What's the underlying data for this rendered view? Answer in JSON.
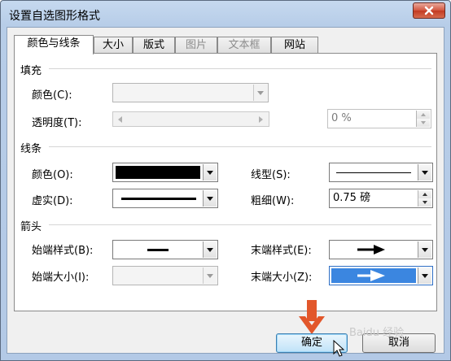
{
  "window": {
    "title": "设置自选图形格式"
  },
  "tabs": [
    {
      "label": "颜色与线条",
      "state": "active"
    },
    {
      "label": "大小",
      "state": "normal"
    },
    {
      "label": "版式",
      "state": "normal"
    },
    {
      "label": "图片",
      "state": "disabled"
    },
    {
      "label": "文本框",
      "state": "disabled"
    },
    {
      "label": "网站",
      "state": "normal"
    }
  ],
  "fill": {
    "heading": "填充",
    "color_label": "颜色(C):",
    "transparency_label": "透明度(T):",
    "transparency_value": "0 %"
  },
  "line": {
    "heading": "线条",
    "color_label": "颜色(O):",
    "color_value": "#000000",
    "dash_label": "虚实(D):",
    "style_label": "线型(S):",
    "weight_label": "粗细(W):",
    "weight_value": "0.75 磅"
  },
  "arrows": {
    "heading": "箭头",
    "begin_style_label": "始端样式(B):",
    "begin_size_label": "始端大小(I):",
    "end_style_label": "末端样式(E):",
    "end_size_label": "末端大小(Z):"
  },
  "buttons": {
    "ok": "确定",
    "cancel": "取消"
  },
  "watermark": "Baidu 经验",
  "colors": {
    "selection": "#3b86e0",
    "arrow_annotation": "#e2572b"
  }
}
